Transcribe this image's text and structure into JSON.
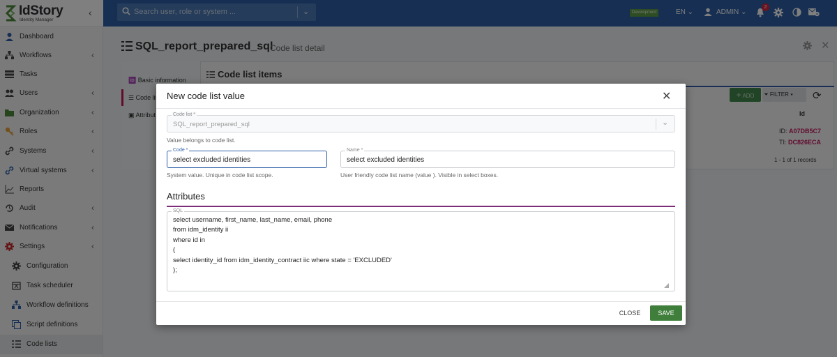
{
  "brand": {
    "name": "IdStory",
    "subtitle": "Identity Manager",
    "collapse_icon": "chevron-left-icon"
  },
  "sidebar": {
    "items": [
      {
        "label": "Dashboard",
        "icon": "user-icon",
        "has_arrow": false
      },
      {
        "label": "Workflows",
        "icon": "sitemap-icon",
        "has_arrow": true
      },
      {
        "label": "Tasks",
        "icon": "tasks-icon",
        "has_arrow": false
      },
      {
        "label": "Users",
        "icon": "users-icon",
        "has_arrow": true
      },
      {
        "label": "Organization",
        "icon": "folder-icon",
        "has_arrow": true
      },
      {
        "label": "Roles",
        "icon": "key-icon",
        "has_arrow": true
      },
      {
        "label": "Systems",
        "icon": "link-icon",
        "has_arrow": true
      },
      {
        "label": "Virtual systems",
        "icon": "link-icon",
        "has_arrow": true
      },
      {
        "label": "Reports",
        "icon": "chart-icon",
        "has_arrow": false
      },
      {
        "label": "Audit",
        "icon": "history-icon",
        "has_arrow": true
      },
      {
        "label": "Notifications",
        "icon": "envelope-icon",
        "has_arrow": true
      },
      {
        "label": "Settings",
        "icon": "gear-icon",
        "has_arrow": true
      },
      {
        "label": "Configuration",
        "icon": "gear-icon",
        "has_arrow": false
      },
      {
        "label": "Task scheduler",
        "icon": "calendar-icon",
        "has_arrow": false
      },
      {
        "label": "Workflow definitions",
        "icon": "sitemap-icon",
        "has_arrow": false
      },
      {
        "label": "Script definitions",
        "icon": "script-icon",
        "has_arrow": false
      },
      {
        "label": "Code lists",
        "icon": "list-icon",
        "has_arrow": false
      }
    ]
  },
  "topbar": {
    "search_placeholder": "Search user, role or system ...",
    "environment": "Development",
    "language": "EN",
    "user": "ADMIN",
    "notification_count": "2"
  },
  "page": {
    "title": "SQL_report_prepared_sql",
    "subtitle": "Code list detail",
    "tabs": [
      "Basic information",
      "Code lis",
      "Attribut"
    ]
  },
  "code_list_items": {
    "heading": "Code list items",
    "add_label": "ADD",
    "filter_label": "FILTER",
    "column_id": "Id",
    "rows": [
      {
        "id_label": "ID:",
        "id_value": "A07DB5C7"
      },
      {
        "id_label": "TI:",
        "id_value": "DC826ECA"
      }
    ],
    "pager": "1 - 1 of 1 records"
  },
  "modal": {
    "title": "New code list value",
    "code_list_label": "Code list *",
    "code_list_value": "SQL_report_prepared_sql",
    "code_list_hint": "Value belongs to code list.",
    "code_label": "Code *",
    "code_value": "select excluded identities",
    "code_hint": "System value. Unique in code list scope.",
    "name_label": "Name *",
    "name_value": "select excluded identities",
    "name_hint": "User friendly code list name (value ). Visible in select boxes.",
    "attributes_heading": "Attributes",
    "sql_label": "SQL",
    "sql_lines": [
      "select username, first_name, last_name, email, phone",
      "from idm_identity ii",
      "where id in",
      "(",
      "select identity_id from idm_identity_contract iic where state = 'EXCLUDED'",
      ");"
    ],
    "close_label": "CLOSE",
    "save_label": "SAVE"
  },
  "colors": {
    "topbar": "#2d5fa6",
    "accent": "#2d5fa6",
    "save": "#3f7f3b",
    "id_value": "#c2185b",
    "attributes_line": "#7b2d7b"
  }
}
